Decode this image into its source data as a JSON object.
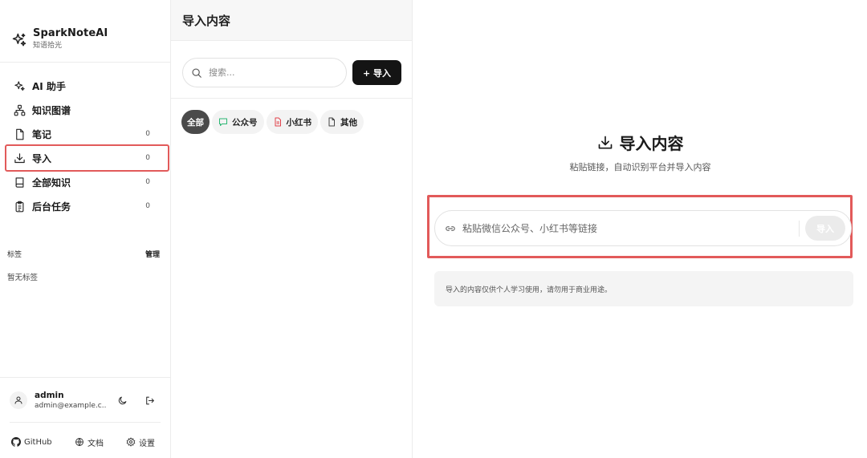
{
  "brand": {
    "name": "SparkNoteAI",
    "subtitle": "知语拾光"
  },
  "sidebar": {
    "items": [
      {
        "label": "AI 助手",
        "icon": "sparkles-icon"
      },
      {
        "label": "知识图谱",
        "icon": "graph-icon"
      },
      {
        "label": "笔记",
        "icon": "note-icon",
        "count": "0"
      },
      {
        "label": "导入",
        "icon": "download-icon",
        "count": "0",
        "active": true
      },
      {
        "label": "全部知识",
        "icon": "book-icon",
        "count": "0"
      },
      {
        "label": "后台任务",
        "icon": "clipboard-icon",
        "count": "0"
      }
    ],
    "tags_label": "标签",
    "tags_manage": "管理",
    "tags_empty": "暂无标签"
  },
  "user": {
    "name": "admin",
    "email": "admin@example.c..."
  },
  "footer": {
    "github": "GitHub",
    "docs": "文档",
    "settings": "设置"
  },
  "middle": {
    "title": "导入内容",
    "search_placeholder": "搜索...",
    "import_button": "+ 导入",
    "filters": [
      {
        "label": "全部",
        "active": true
      },
      {
        "label": "公众号",
        "icon": "wechat-icon",
        "color": "#2bb673"
      },
      {
        "label": "小红书",
        "icon": "xiaohongshu-icon",
        "color": "#e0404a"
      },
      {
        "label": "其他",
        "icon": "file-icon"
      }
    ]
  },
  "main": {
    "title": "导入内容",
    "subtitle": "粘贴链接，自动识别平台并导入内容",
    "link_placeholder": "粘贴微信公众号、小红书等链接",
    "import_button": "导入",
    "notice": "导入的内容仅供个人学习使用，请勿用于商业用途。"
  },
  "colors": {
    "highlight": "#e25a5a",
    "primary": "#141414"
  }
}
